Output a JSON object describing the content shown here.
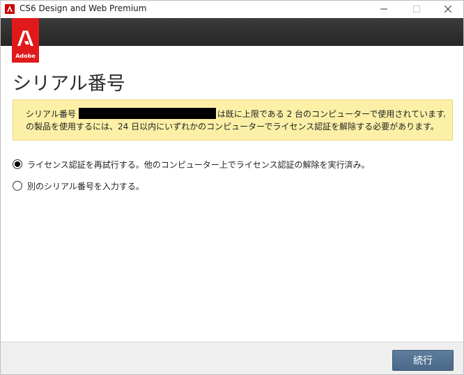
{
  "window": {
    "title": "CS6 Design and Web Premium"
  },
  "header": {
    "logo_text": "Adobe",
    "brand_color": "#e01a1a"
  },
  "page": {
    "title": "シリアル番号"
  },
  "notice": {
    "line1_prefix": "シリアル番号",
    "line1_suffix": "は既に上限である 2 台のコンピューターで使用されています。こ",
    "line2": "の製品を使用するには、24 日以内にいずれかのコンピューターでライセンス認証を解除する必要があります。"
  },
  "options": [
    {
      "label": "ライセンス認証を再試行する。他のコンピューター上でライセンス認証の解除を実行済み。",
      "selected": true
    },
    {
      "label": "別のシリアル番号を入力する。",
      "selected": false
    }
  ],
  "footer": {
    "continue_label": "続行"
  },
  "icons": {
    "app": "adobe-app-icon",
    "minimize": "minimize-icon",
    "maximize": "maximize-icon",
    "close": "close-icon"
  }
}
